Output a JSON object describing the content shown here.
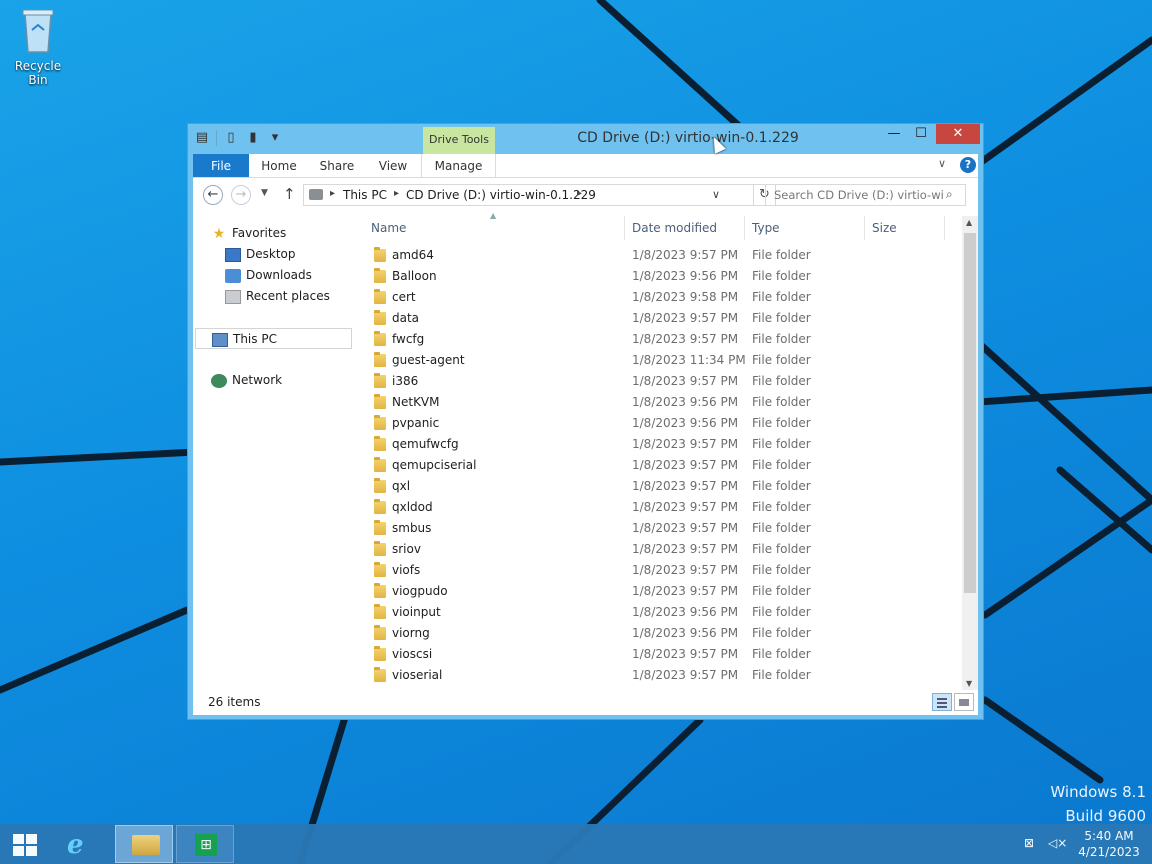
{
  "desktop": {
    "recycle_bin_label": "Recycle Bin",
    "watermark_line1": "Windows 8.1",
    "watermark_line2": "Build 9600",
    "colors": {
      "background": "#1291e2",
      "accent": "#1979ca"
    }
  },
  "window": {
    "title": "CD Drive (D:) virtio-win-0.1.229",
    "context_tab": "Drive Tools",
    "controls": {
      "minimize": "—",
      "maximize": "☐",
      "close": "✕"
    },
    "ribbon_tabs": [
      {
        "label": "File"
      },
      {
        "label": "Home"
      },
      {
        "label": "Share"
      },
      {
        "label": "View"
      },
      {
        "label": "Manage"
      }
    ],
    "help": "?",
    "address": {
      "crumbs": [
        "This PC",
        "CD Drive (D:) virtio-win-0.1.229"
      ],
      "search_placeholder": "Search CD Drive (D:) virtio-wi..."
    },
    "nav_pane": {
      "favorites": "Favorites",
      "favorites_items": [
        "Desktop",
        "Downloads",
        "Recent places"
      ],
      "this_pc": "This PC",
      "network": "Network"
    },
    "columns": [
      "Name",
      "Date modified",
      "Type",
      "Size"
    ],
    "files": [
      {
        "name": "amd64",
        "date": "1/8/2023 9:57 PM",
        "type": "File folder"
      },
      {
        "name": "Balloon",
        "date": "1/8/2023 9:56 PM",
        "type": "File folder"
      },
      {
        "name": "cert",
        "date": "1/8/2023 9:58 PM",
        "type": "File folder"
      },
      {
        "name": "data",
        "date": "1/8/2023 9:57 PM",
        "type": "File folder"
      },
      {
        "name": "fwcfg",
        "date": "1/8/2023 9:57 PM",
        "type": "File folder"
      },
      {
        "name": "guest-agent",
        "date": "1/8/2023 11:34 PM",
        "type": "File folder"
      },
      {
        "name": "i386",
        "date": "1/8/2023 9:57 PM",
        "type": "File folder"
      },
      {
        "name": "NetKVM",
        "date": "1/8/2023 9:56 PM",
        "type": "File folder"
      },
      {
        "name": "pvpanic",
        "date": "1/8/2023 9:56 PM",
        "type": "File folder"
      },
      {
        "name": "qemufwcfg",
        "date": "1/8/2023 9:57 PM",
        "type": "File folder"
      },
      {
        "name": "qemupciserial",
        "date": "1/8/2023 9:57 PM",
        "type": "File folder"
      },
      {
        "name": "qxl",
        "date": "1/8/2023 9:57 PM",
        "type": "File folder"
      },
      {
        "name": "qxldod",
        "date": "1/8/2023 9:57 PM",
        "type": "File folder"
      },
      {
        "name": "smbus",
        "date": "1/8/2023 9:57 PM",
        "type": "File folder"
      },
      {
        "name": "sriov",
        "date": "1/8/2023 9:57 PM",
        "type": "File folder"
      },
      {
        "name": "viofs",
        "date": "1/8/2023 9:57 PM",
        "type": "File folder"
      },
      {
        "name": "viogpudo",
        "date": "1/8/2023 9:57 PM",
        "type": "File folder"
      },
      {
        "name": "vioinput",
        "date": "1/8/2023 9:56 PM",
        "type": "File folder"
      },
      {
        "name": "viorng",
        "date": "1/8/2023 9:56 PM",
        "type": "File folder"
      },
      {
        "name": "vioscsi",
        "date": "1/8/2023 9:57 PM",
        "type": "File folder"
      },
      {
        "name": "vioserial",
        "date": "1/8/2023 9:57 PM",
        "type": "File folder"
      }
    ],
    "status": "26 items"
  },
  "taskbar": {
    "apps": [
      "start-icon",
      "internet-explorer-icon",
      "file-explorer-icon",
      "store-icon"
    ],
    "time": "5:40 AM",
    "date": "4/21/2023"
  }
}
